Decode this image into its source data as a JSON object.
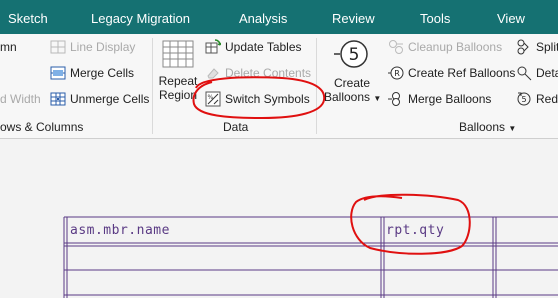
{
  "tabs": [
    "Sketch",
    "Legacy Migration",
    "Analysis",
    "Review",
    "Tools",
    "View"
  ],
  "ribbon": {
    "rows_columns": {
      "line_display": "Line Display",
      "merge_cells": "Merge Cells",
      "unmerge_cells": "Unmerge Cells",
      "column_partial": "mn",
      "width_partial": "d Width",
      "group_label": "ows & Columns"
    },
    "data": {
      "repeat_region_line1": "Repeat",
      "repeat_region_line2": "Region",
      "update_tables": "Update Tables",
      "delete_contents": "Delete Contents",
      "switch_symbols": "Switch Symbols",
      "group_label": "Data"
    },
    "balloons": {
      "create_balloons_line1": "Create",
      "create_balloons_line2": "Balloons",
      "balloon_glyph": "5",
      "cleanup_balloons": "Cleanup Balloons",
      "create_ref_balloons": "Create Ref Balloons",
      "merge_balloons": "Merge Balloons",
      "split_partial": "Split",
      "detach_partial": "Deta",
      "redistribute_partial": "Red",
      "group_label": "Balloons"
    }
  },
  "table": {
    "name_cell": "asm.mbr.name",
    "qty_cell": "rpt.qty"
  },
  "colors": {
    "tab_bar": "#157172",
    "table_lines": "#5a3a84",
    "annotation": "#e01010"
  }
}
